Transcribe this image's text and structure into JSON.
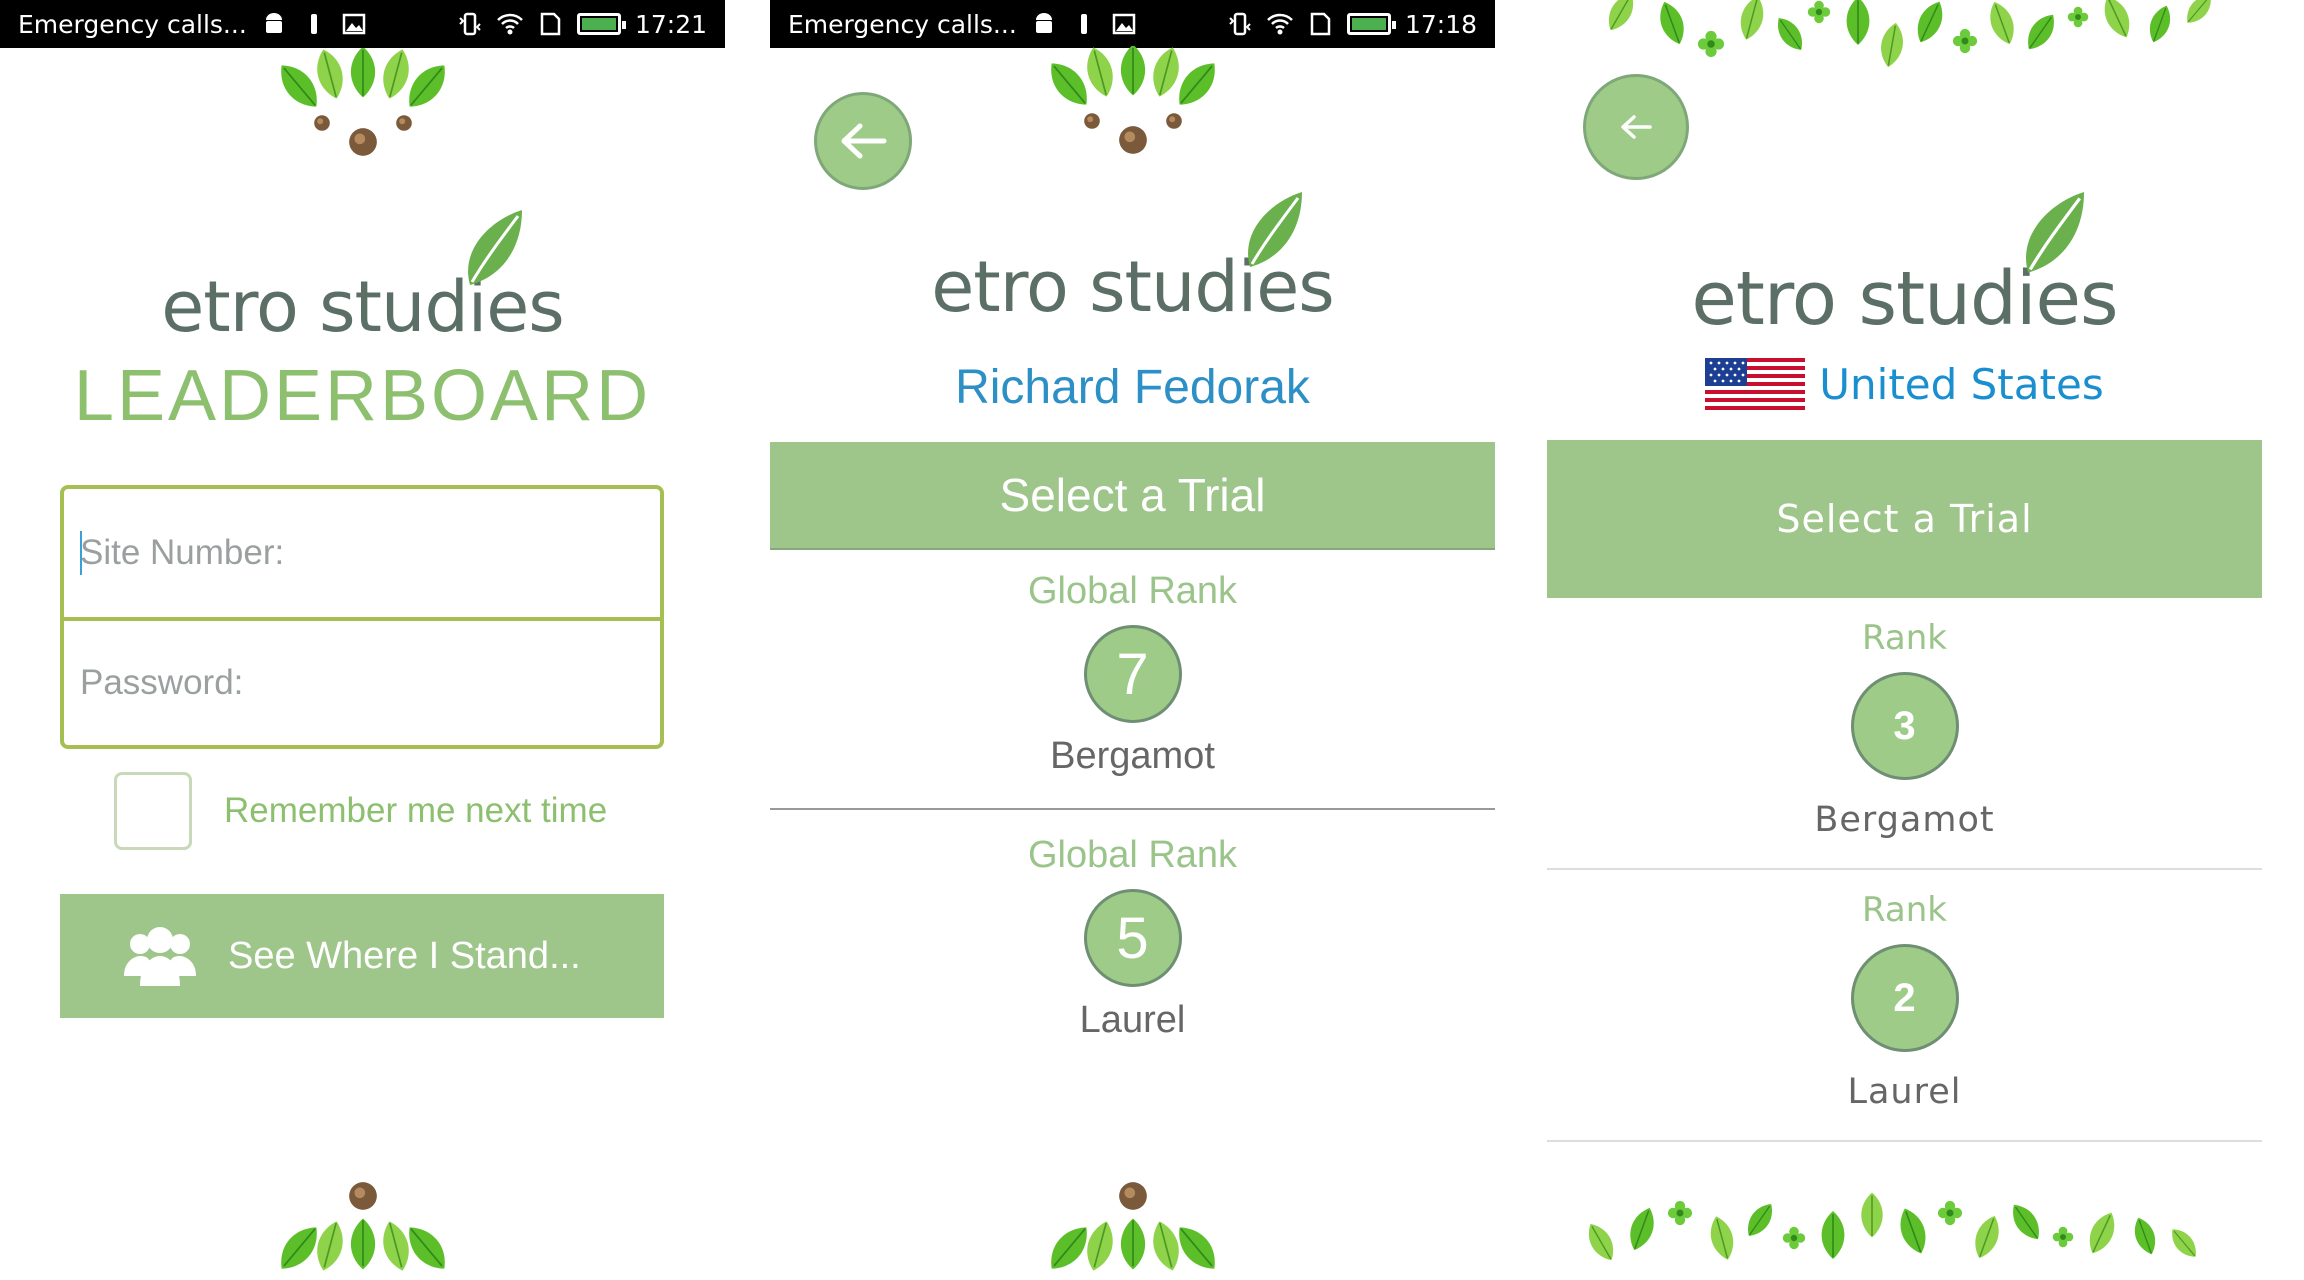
{
  "colors": {
    "accent_green": "#9fc68a",
    "title_green": "#8cbf6e",
    "border_olive": "#a6bf52",
    "name_blue": "#2c8fc5",
    "logo_gray": "#5b6f67"
  },
  "panel1": {
    "status": {
      "notification": "Emergency calls...",
      "time": "17:21"
    },
    "logo": "etro studies",
    "title": "LEADERBOARD",
    "site_placeholder": "Site Number:",
    "password_placeholder": "Password:",
    "remember_label": "Remember me next time",
    "button_label": "See Where I Stand...",
    "button_icon": "users-icon"
  },
  "panel2": {
    "status": {
      "notification": "Emergency calls...",
      "time": "17:18"
    },
    "logo": "etro studies",
    "user_name": "Richard Fedorak",
    "select_trial": "Select a Trial",
    "rankings": [
      {
        "label": "Global Rank",
        "rank": "7",
        "trial": "Bergamot"
      },
      {
        "label": "Global Rank",
        "rank": "5",
        "trial": "Laurel"
      }
    ]
  },
  "panel3": {
    "logo": "etro studies",
    "country": "United States",
    "flag_icon": "us-flag-icon",
    "select_trial": "Select a Trial",
    "rankings": [
      {
        "label": "Rank",
        "rank": "3",
        "trial": "Bergamot"
      },
      {
        "label": "Rank",
        "rank": "2",
        "trial": "Laurel"
      }
    ]
  }
}
